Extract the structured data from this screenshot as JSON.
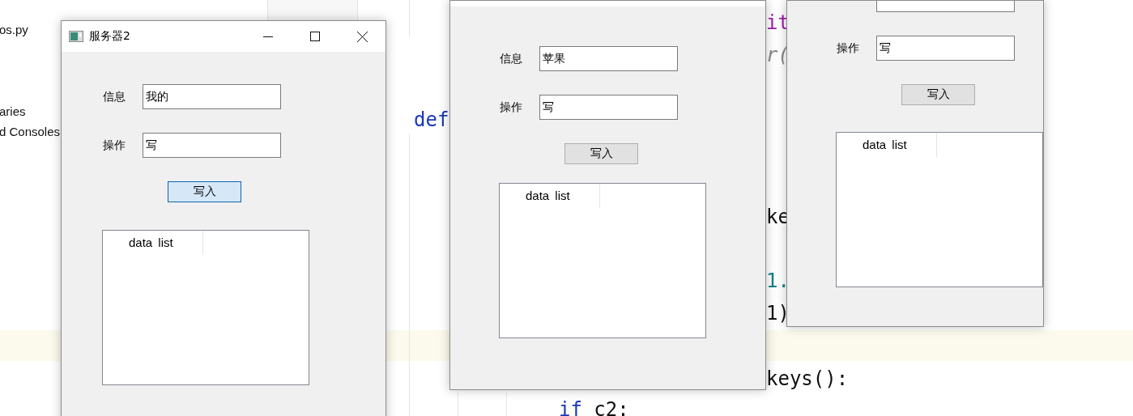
{
  "project_tree": {
    "items": [
      "os.py",
      "aries",
      "d Consoles"
    ]
  },
  "editor": {
    "lines": [
      {
        "tokens": [
          {
            "text": "it",
            "kind": "self"
          }
        ]
      },
      {
        "tokens": [
          {
            "text": "r(",
            "kind": "param"
          }
        ]
      },
      {
        "tokens": [
          {
            "text": "def",
            "kind": "keyword"
          }
        ]
      },
      {
        "tokens": [
          {
            "text": "ke",
            "kind": "plain"
          }
        ]
      },
      {
        "tokens": [
          {
            "text": "1.",
            "kind": "number"
          }
        ]
      },
      {
        "tokens": [
          {
            "text": "1)",
            "kind": "plain"
          }
        ]
      },
      {
        "tokens": [
          {
            "text": "keys():",
            "kind": "plain"
          }
        ]
      },
      {
        "tokens": [
          {
            "text": "if",
            "kind": "keyword"
          },
          {
            "text": " c2:",
            "kind": "plain"
          }
        ]
      }
    ]
  },
  "windows": [
    {
      "title": "服务器2",
      "fields": [
        {
          "label": "信息",
          "value": "我的"
        },
        {
          "label": "操作",
          "value": "写"
        }
      ],
      "button": {
        "label": "写入",
        "focused": true
      },
      "list_header": "data list"
    },
    {
      "fields": [
        {
          "label": "信息",
          "value": "苹果"
        },
        {
          "label": "操作",
          "value": "写"
        }
      ],
      "button": {
        "label": "写入",
        "focused": false
      },
      "list_header": "data list"
    },
    {
      "fields": [
        {
          "label": "操作",
          "value": "写"
        }
      ],
      "button": {
        "label": "写入",
        "focused": false
      },
      "list_header": "data list"
    }
  ]
}
